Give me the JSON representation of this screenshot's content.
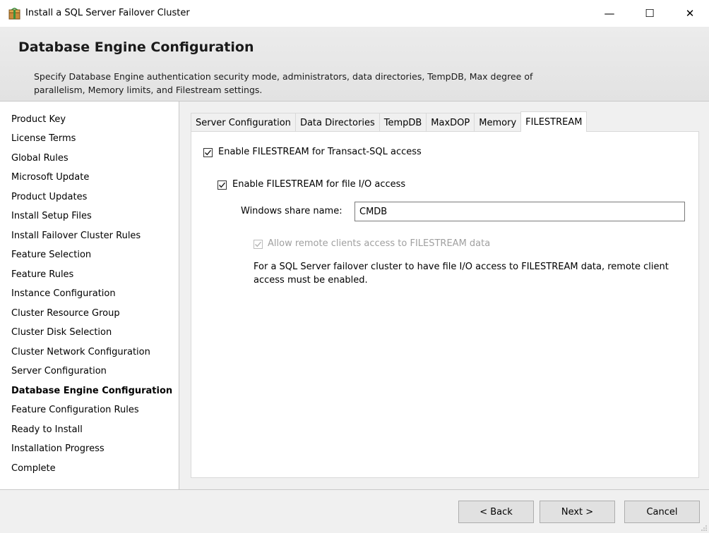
{
  "window": {
    "title": "Install a SQL Server Failover Cluster",
    "minimize_glyph": "—",
    "maximize_glyph": "☐",
    "close_glyph": "✕"
  },
  "header": {
    "title": "Database Engine Configuration",
    "description": "Specify Database Engine authentication security mode, administrators, data directories, TempDB, Max degree of parallelism, Memory limits, and Filestream settings."
  },
  "nav": {
    "items": [
      {
        "label": "Product Key"
      },
      {
        "label": "License Terms"
      },
      {
        "label": "Global Rules"
      },
      {
        "label": "Microsoft Update"
      },
      {
        "label": "Product Updates"
      },
      {
        "label": "Install Setup Files"
      },
      {
        "label": "Install Failover Cluster Rules"
      },
      {
        "label": "Feature Selection"
      },
      {
        "label": "Feature Rules"
      },
      {
        "label": "Instance Configuration"
      },
      {
        "label": "Cluster Resource Group"
      },
      {
        "label": "Cluster Disk Selection"
      },
      {
        "label": "Cluster Network Configuration"
      },
      {
        "label": "Server Configuration"
      },
      {
        "label": "Database Engine Configuration"
      },
      {
        "label": "Feature Configuration Rules"
      },
      {
        "label": "Ready to Install"
      },
      {
        "label": "Installation Progress"
      },
      {
        "label": "Complete"
      }
    ],
    "active_label": "Database Engine Configuration"
  },
  "tabs": [
    {
      "label": "Server Configuration"
    },
    {
      "label": "Data Directories"
    },
    {
      "label": "TempDB"
    },
    {
      "label": "MaxDOP"
    },
    {
      "label": "Memory"
    },
    {
      "label": "FILESTREAM"
    }
  ],
  "active_tab": "FILESTREAM",
  "filestream": {
    "tsql_access": {
      "label": "Enable FILESTREAM for Transact-SQL access",
      "checked": true
    },
    "file_io_access": {
      "label": "Enable FILESTREAM for file I/O access",
      "checked": true
    },
    "share_name_label": "Windows share name:",
    "share_name_value": "CMDB",
    "remote_clients": {
      "label": "Allow remote clients access to FILESTREAM data",
      "checked": true,
      "enabled": false
    },
    "info": "For a SQL Server failover cluster to have file I/O access to FILESTREAM data, remote client access must be enabled."
  },
  "footer": {
    "back": "< Back",
    "next": "Next >",
    "cancel": "Cancel"
  }
}
